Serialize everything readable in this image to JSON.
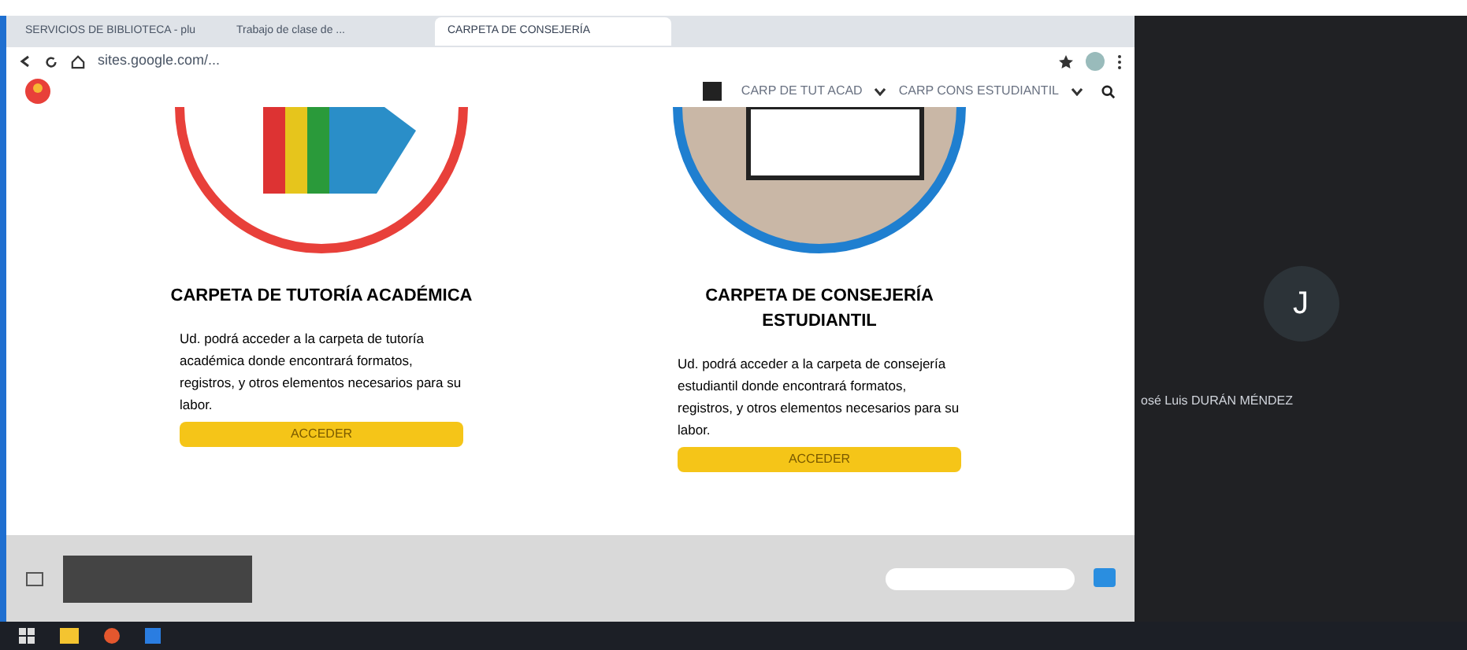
{
  "browser": {
    "tabs": [
      {
        "title": "SERVICIOS DE BIBLIOTECA - plu",
        "selected": false
      },
      {
        "title": "Trabajo de clase de ...",
        "selected": false
      },
      {
        "title": "CARPETA DE CONSEJERÍA",
        "selected": true
      }
    ],
    "address": "sites.google.com/..."
  },
  "site": {
    "nav": [
      {
        "label": "CARP DE TUT ACAD"
      },
      {
        "label": "CARP CONS ESTUDIANTIL"
      }
    ],
    "cards": [
      {
        "kind": "folders",
        "title": "CARPETA DE TUTORÍA ACADÉMICA",
        "text": "Ud. podrá acceder a la carpeta de tutoría académica donde encontrará formatos, registros, y otros elementos necesarios para su labor.",
        "button": "ACCEDER",
        "color": "#e8403a"
      },
      {
        "kind": "laptop",
        "title": "CARPETA DE CONSEJERÍA ESTUDIANTIL",
        "text": "Ud. podrá acceder a la carpeta de consejería estudiantil donde encontrará formatos, registros, y otros elementos necesarios para su labor.",
        "button": "ACCEDER",
        "color": "#1f7fd0"
      }
    ]
  },
  "participant": {
    "initial": "J",
    "name": "osé Luis DURÁN MÉNDEZ"
  }
}
